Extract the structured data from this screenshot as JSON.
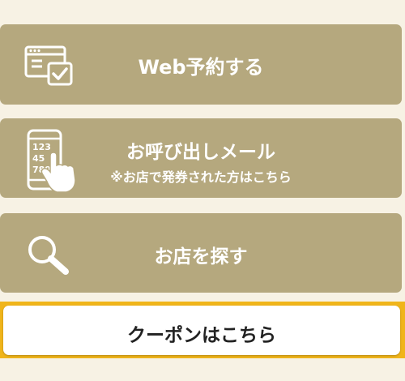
{
  "menu": {
    "web_reserve": {
      "label": "Web予約する",
      "icon": "web-reservation-icon"
    },
    "call_mail": {
      "label": "お呼び出しメール",
      "sublabel": "※お店で発券された方はこちら",
      "icon": "phone-tap-icon",
      "icon_digits": [
        "123",
        "45",
        "789"
      ]
    },
    "store_search": {
      "label": "お店を探す",
      "icon": "search-icon"
    },
    "coupon": {
      "label": "クーポンはこちら"
    }
  },
  "colors": {
    "background": "#f7f2e4",
    "button": "#b5a87e",
    "button_text": "#ffffff",
    "coupon_highlight": "#f0b51a",
    "coupon_button": "#ffffff",
    "coupon_text": "#222222"
  }
}
